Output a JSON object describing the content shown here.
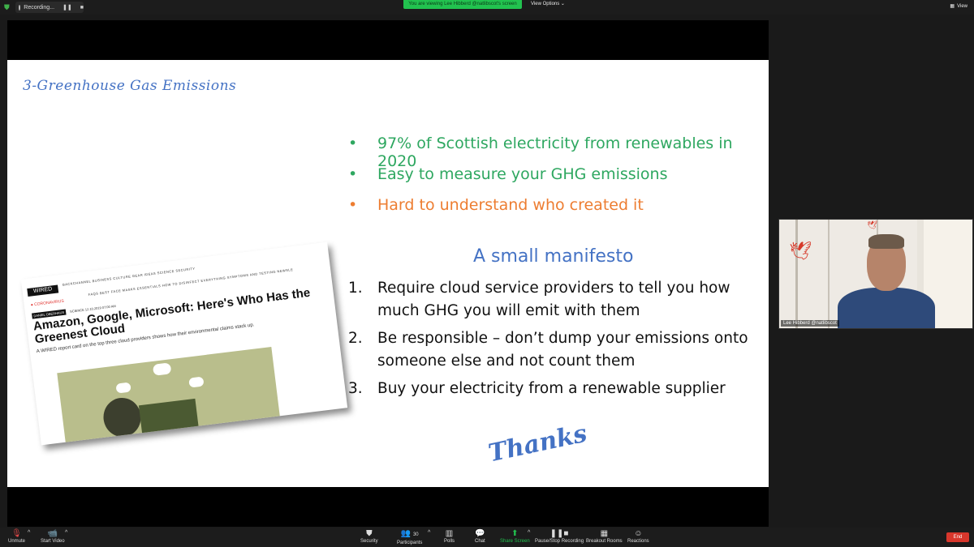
{
  "topbar": {
    "recording_label": "Recording...",
    "pause_icon": "pause-icon",
    "stop_icon": "stop-icon",
    "viewing_banner": "You are viewing Lee Hibberd @natlibscot's screen",
    "view_options": "View Options",
    "view_label": "View"
  },
  "slide": {
    "title": "3-Greenhouse Gas Emissions",
    "bullets": [
      {
        "marker": "•",
        "text": "97% of Scottish electricity from renewables in 2020",
        "color": "#2ea760"
      },
      {
        "marker": "•",
        "text": "Easy to measure your GHG emissions",
        "color": "#2ea760"
      },
      {
        "marker": "•",
        "text": "Hard to understand who created it",
        "color": "#ed7d31"
      }
    ],
    "manifesto_heading": "A small manifesto",
    "manifesto_items": [
      {
        "num": "1.",
        "text": "Require cloud service providers to tell you how much GHG you will emit with them"
      },
      {
        "num": "2.",
        "text": "Be responsible – don’t dump your emissions onto someone else and not count them"
      },
      {
        "num": "3.",
        "text": "Buy your electricity from a renewable supplier"
      }
    ],
    "thanks": "Thanks",
    "article": {
      "logo": "WIRED",
      "nav": "BACKCHANNEL  BUSINESS  CULTURE  GEAR  IDEAS  SCIENCE  SECURITY",
      "nav2": "FAQS   BEST FACE MASKS   ESSENTIALS   HOW TO DISINFECT EVERYTHING   SYMPTOMS AND TESTING   NEWSLE",
      "corona": "● CORONAVIRUS",
      "byline_tag": "DANIEL OBERHAUS",
      "byline": "SCIENCE  12.10.2019 07:00 AM",
      "headline": "Amazon, Google, Microsoft: Here's Who Has the Greenest Cloud",
      "subhead": "A WIRED report card on the top three cloud providers shows how their environmental claims stack up."
    }
  },
  "video": {
    "name": "Lee Hibberd @natlibscot"
  },
  "toolbar": {
    "unmute": "Unmute",
    "start_video": "Start Video",
    "security": "Security",
    "participants": "Participants",
    "participants_count": "30",
    "polls": "Polls",
    "chat": "Chat",
    "share_screen": "Share Screen",
    "recording": "Pause/Stop Recording",
    "breakout": "Breakout Rooms",
    "reactions": "Reactions",
    "end": "End"
  },
  "colors": {
    "accent_blue": "#4472c4",
    "green": "#2ea760",
    "orange": "#ed7d31",
    "banner_green": "#22c24f",
    "end_red": "#d8372c"
  }
}
